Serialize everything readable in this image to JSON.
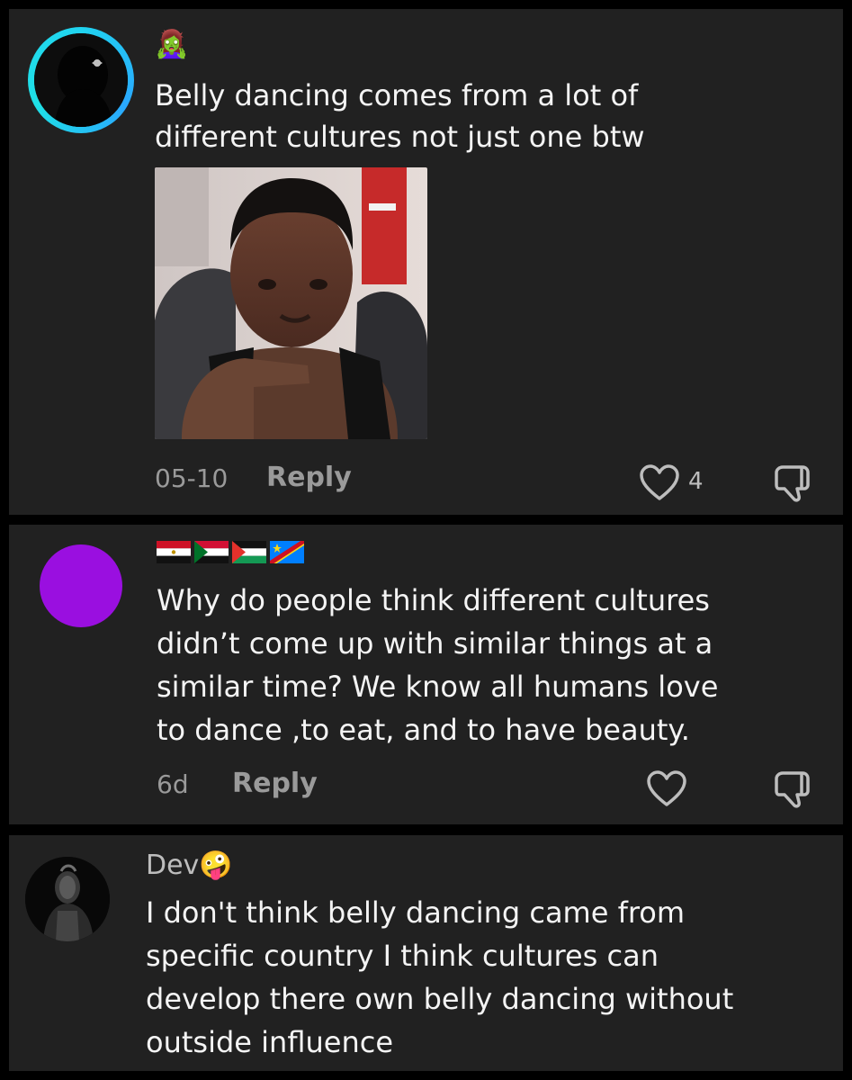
{
  "comments": [
    {
      "author_emoji": "🧟‍♀️",
      "text_lines": [
        "Belly dancing comes from a lot of",
        "different cultures not just one btw"
      ],
      "date": "05-10",
      "reply_label": "Reply",
      "likes": "4",
      "has_image": true
    },
    {
      "author_flags": [
        "egypt",
        "sudan",
        "palestine",
        "dr-congo"
      ],
      "text_lines": [
        "Why do people think different cultures",
        "didn’t come up with similar things at a",
        "similar time? We know all humans love",
        "to dance ,to eat, and to have beauty."
      ],
      "date": "6d",
      "reply_label": "Reply",
      "avatar_color": "#9a0fe0"
    },
    {
      "author_name": "Dev",
      "author_emoji": "🤪",
      "text_lines": [
        "I don't think belly dancing came from",
        "specific country I think cultures can",
        "develop there own belly dancing without",
        "outside influence"
      ]
    }
  ],
  "icons": {
    "like": "heart-icon",
    "dislike": "thumbs-down-icon"
  },
  "colors": {
    "card_bg": "#212121",
    "ring": "#20d4f0",
    "purple_avatar": "#9a0fe0"
  }
}
